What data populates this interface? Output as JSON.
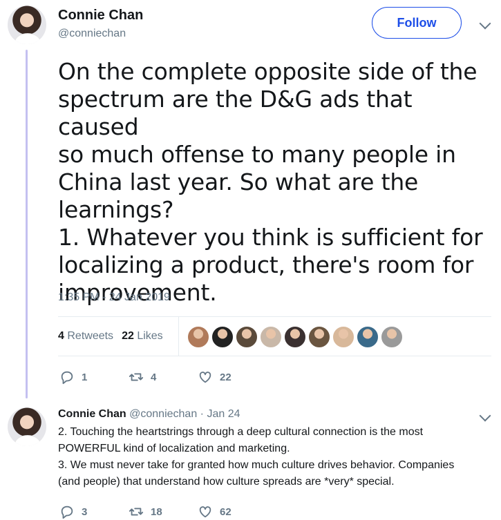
{
  "tweet": {
    "author_name": "Connie Chan",
    "author_handle": "@conniechan",
    "follow_label": "Follow",
    "text": "On the complete opposite side of the\nspectrum are the D&G ads that caused\nso much offense to many people in\nChina last year. So what are the\nlearnings?\n1. Whatever you think is sufficient for\nlocalizing a product, there's room for\nimprovement.",
    "timestamp": "1:35 PM - 24 Jan 2019",
    "retweets_count": "4",
    "retweets_label": "Retweets",
    "likes_count": "22",
    "likes_label": "Likes",
    "replies": "1",
    "retweets": "4",
    "likes": "22",
    "liker_avatar_colors": [
      "#b07a5a",
      "#222222",
      "#5a4a3a",
      "#c9b8a8",
      "#3a3030",
      "#6a5540",
      "#d8b89a",
      "#3a6a8a",
      "#9a9a9a"
    ]
  },
  "reply": {
    "author_name": "Connie Chan",
    "author_handle": "@conniechan",
    "date": "Jan 24",
    "text": "2. Touching the heartstrings through a deep cultural connection is the most\nPOWERFUL kind of localization and marketing.\n3. We must never take for granted how much culture drives behavior. Companies\n(and people) that understand how culture spreads are *very* special.",
    "replies": "3",
    "retweets": "18",
    "likes": "62"
  },
  "colors": {
    "accent": "#1d4ee8",
    "thread_line": "#c4c0f0",
    "muted": "#657786"
  }
}
